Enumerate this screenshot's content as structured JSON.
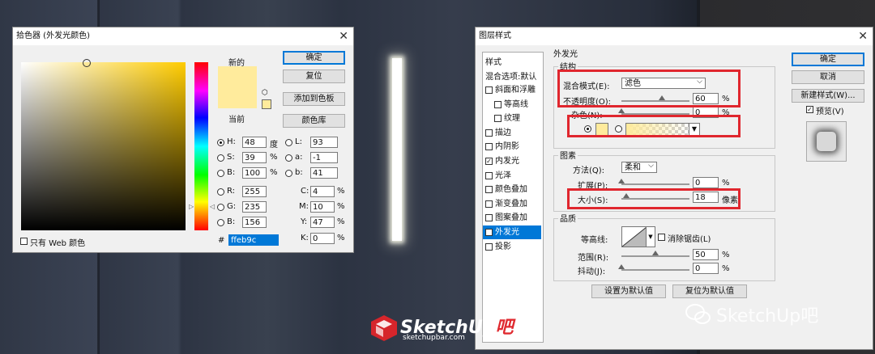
{
  "picker": {
    "title": "拾色器 (外发光颜色)",
    "new_label": "新的",
    "current_label": "当前",
    "ok": "确定",
    "reset": "复位",
    "add_swatch": "添加到色板",
    "libraries": "颜色库",
    "web_only": "只有 Web 颜色",
    "fields": {
      "H": {
        "label": "H:",
        "value": "48",
        "unit": "度"
      },
      "S": {
        "label": "S:",
        "value": "39",
        "unit": "%"
      },
      "B": {
        "label": "B:",
        "value": "100",
        "unit": "%"
      },
      "R": {
        "label": "R:",
        "value": "255"
      },
      "G": {
        "label": "G:",
        "value": "235"
      },
      "Bb": {
        "label": "B:",
        "value": "156"
      },
      "L": {
        "label": "L:",
        "value": "93"
      },
      "a": {
        "label": "a:",
        "value": "-1"
      },
      "b": {
        "label": "b:",
        "value": "41"
      },
      "C": {
        "label": "C:",
        "value": "4",
        "unit": "%"
      },
      "M": {
        "label": "M:",
        "value": "10",
        "unit": "%"
      },
      "Y": {
        "label": "Y:",
        "value": "47",
        "unit": "%"
      },
      "K": {
        "label": "K:",
        "value": "0",
        "unit": "%"
      }
    },
    "hex_label": "#",
    "hex": "ffeb9c",
    "colors": {
      "new": "#ffeb9c",
      "current": "#ffeb9c",
      "hue": "#ffcc00"
    }
  },
  "layer_style": {
    "title": "图层样式",
    "styles_header": "样式",
    "blend_default": "混合选项:默认",
    "items": [
      {
        "label": "斜面和浮雕",
        "checked": false,
        "indent": false
      },
      {
        "label": "等高线",
        "checked": false,
        "indent": true
      },
      {
        "label": "纹理",
        "checked": false,
        "indent": true
      },
      {
        "label": "描边",
        "checked": false,
        "indent": false
      },
      {
        "label": "内阴影",
        "checked": false,
        "indent": false
      },
      {
        "label": "内发光",
        "checked": true,
        "indent": false
      },
      {
        "label": "光泽",
        "checked": false,
        "indent": false
      },
      {
        "label": "颜色叠加",
        "checked": false,
        "indent": false
      },
      {
        "label": "渐变叠加",
        "checked": false,
        "indent": false
      },
      {
        "label": "图案叠加",
        "checked": false,
        "indent": false
      },
      {
        "label": "外发光",
        "checked": true,
        "indent": false,
        "selected": true
      },
      {
        "label": "投影",
        "checked": false,
        "indent": false
      }
    ],
    "section_title": "外发光",
    "structure_title": "结构",
    "blend_mode_label": "混合模式(E):",
    "blend_mode_value": "滤色",
    "opacity_label": "不透明度(O):",
    "opacity_value": "60",
    "opacity_fraction": 0.6,
    "noise_label": "杂色(N):",
    "noise_value": "0",
    "noise_fraction": 0,
    "percent": "%",
    "elements_title": "图素",
    "method_label": "方法(Q):",
    "method_value": "柔和",
    "spread_label": "扩展(P):",
    "spread_value": "0",
    "spread_fraction": 0,
    "size_label": "大小(S):",
    "size_value": "18",
    "size_fraction": 0.07,
    "size_unit": "像素",
    "quality_title": "品质",
    "contour_label": "等高线:",
    "antialias_label": "消除锯齿(L)",
    "range_label": "范围(R):",
    "range_value": "50",
    "range_fraction": 0.5,
    "jitter_label": "抖动(J):",
    "jitter_value": "0",
    "jitter_fraction": 0,
    "set_default": "设置为默认值",
    "reset_default": "复位为默认值",
    "ok": "确定",
    "cancel": "取消",
    "new_style": "新建样式(W)...",
    "preview": "预览(V)",
    "glow_color": "#ffeb9c"
  },
  "watermark": {
    "brand_left": "SketchUp",
    "brand_left_suffix": "吧",
    "brand_url": "sketchupbar.com",
    "brand_right": "SketchUp吧"
  }
}
